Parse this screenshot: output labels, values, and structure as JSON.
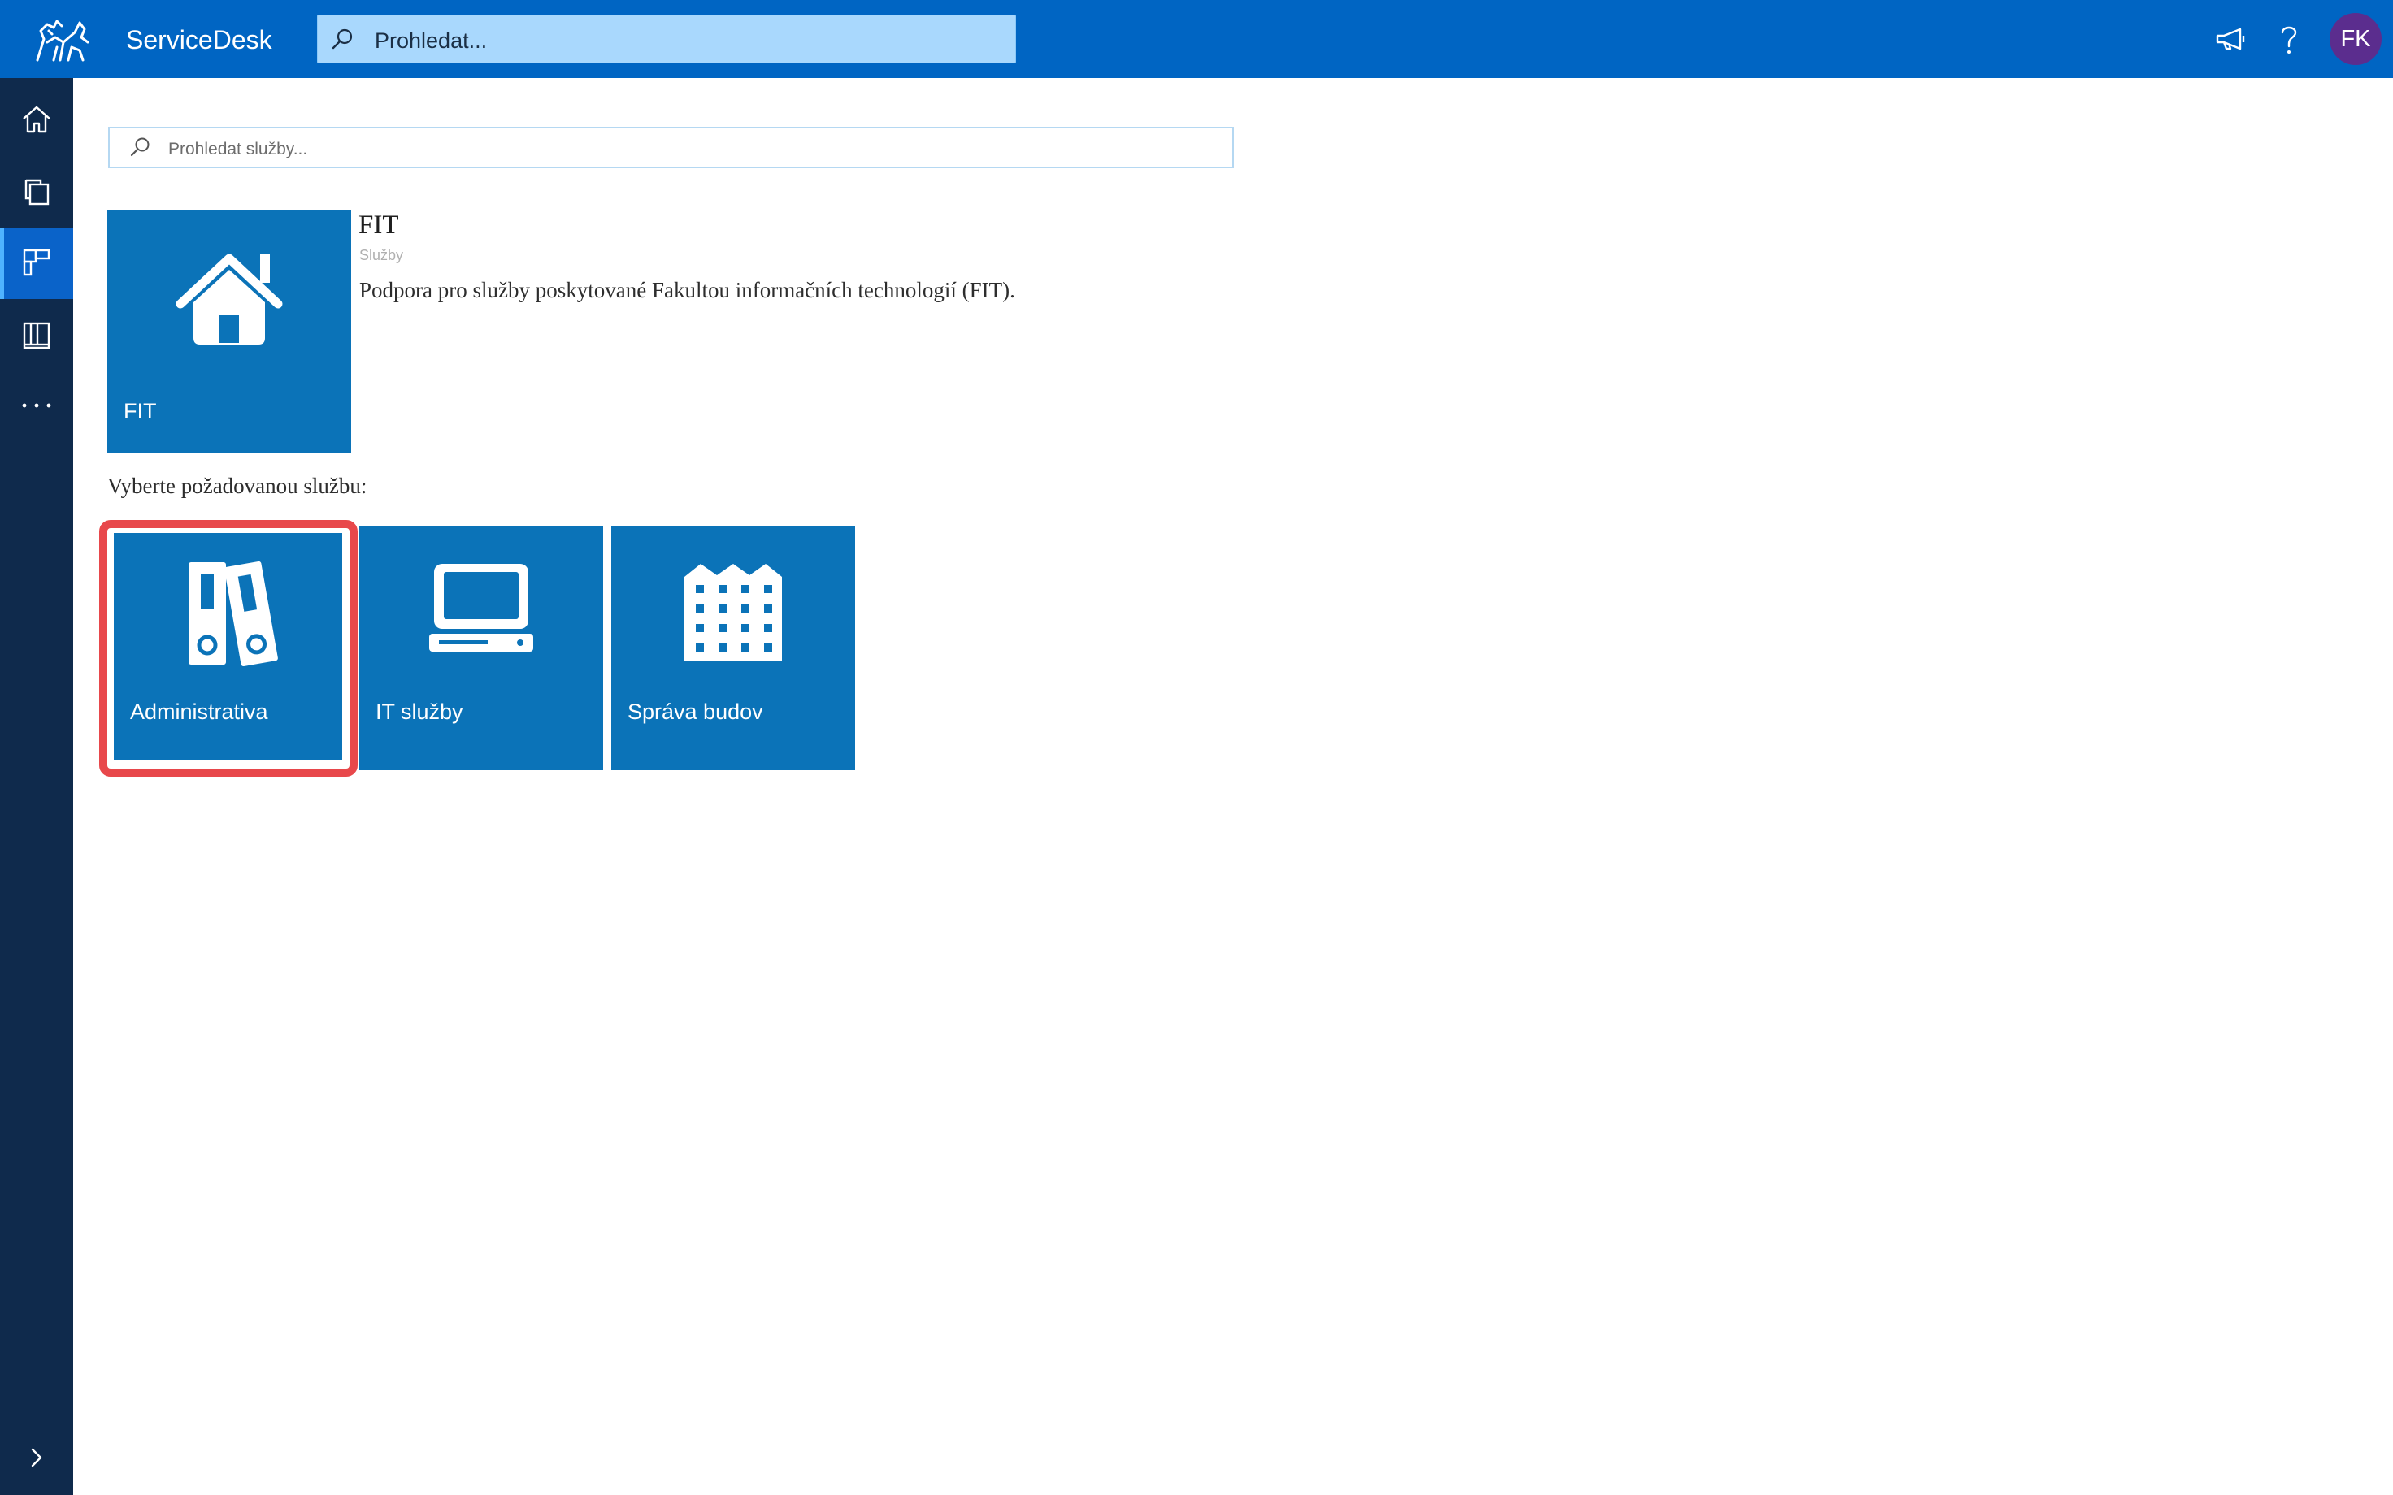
{
  "header": {
    "app_title": "ServiceDesk",
    "search_placeholder": "Prohledat...",
    "user_initials": "FK",
    "colors": {
      "bar": "#0065c3",
      "avatar": "#5b2d8e"
    },
    "icons": [
      "ctu-lion-logo",
      "megaphone-icon",
      "help-icon"
    ]
  },
  "sidebar": {
    "icons": [
      "home-icon",
      "copy-icon",
      "catalog-icon",
      "book-icon",
      "more-icon",
      "chevron-right-icon"
    ],
    "active_index": 2
  },
  "main": {
    "service_search_placeholder": "Prohledat služby...",
    "category": {
      "tile_label": "FIT",
      "heading": "FIT",
      "subheading": "Služby",
      "description": "Podpora pro služby poskytované Fakultou informačních technologií (FIT).",
      "icon": "house-icon"
    },
    "choose_label": "Vyberte požadovanou službu:",
    "services": [
      {
        "label": "Administrativa",
        "icon": "binders-icon",
        "highlighted": true
      },
      {
        "label": "IT služby",
        "icon": "computer-icon",
        "highlighted": false
      },
      {
        "label": "Správa budov",
        "icon": "building-icon",
        "highlighted": false
      }
    ],
    "colors": {
      "tile": "#0b73b8",
      "highlight": "#e8484b"
    }
  }
}
